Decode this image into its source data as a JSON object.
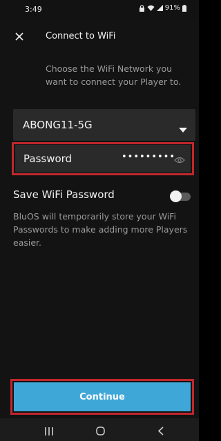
{
  "status_bar": {
    "time": "3:49",
    "battery": "91%",
    "icons": [
      "lock-icon",
      "wifi-icon",
      "signal-icon",
      "battery-icon"
    ]
  },
  "header": {
    "close_icon": "close-icon",
    "title": "Connect to WiFi",
    "subtitle": "Choose the WiFi Network you want to connect your Player to."
  },
  "network": {
    "selected": "ABONG11-5G",
    "caret_icon": "caret-down-icon"
  },
  "password": {
    "label": "Password",
    "masked_value": "•••••••••",
    "eye_icon": "eye-icon"
  },
  "save_wifi": {
    "label": "Save WiFi Password",
    "enabled": false,
    "description": "BluOS will temporarily store your WiFi Passwords to make adding more Players easier."
  },
  "continue_label": "Continue",
  "colors": {
    "accent": "#3fa7d8",
    "highlight": "#c1272d",
    "background": "#131313",
    "field": "#2a2a2a"
  },
  "nav": [
    "recents-icon",
    "home-icon",
    "back-icon"
  ]
}
